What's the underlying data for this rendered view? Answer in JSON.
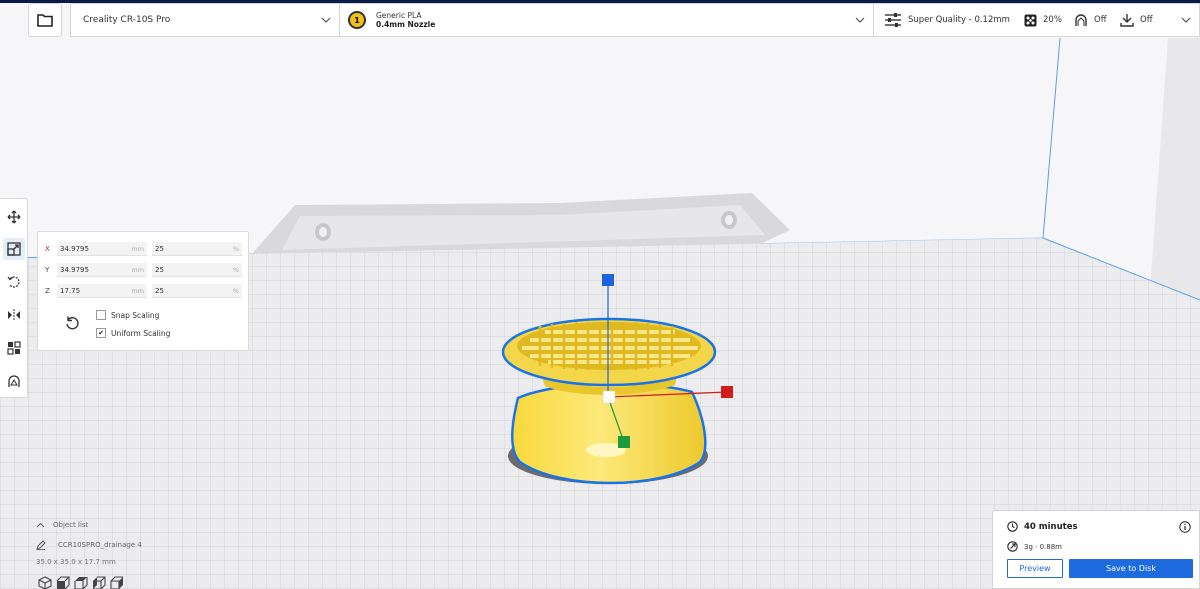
{
  "printer": {
    "name": "Creality CR-10S Pro"
  },
  "material": {
    "extruder_number": "1",
    "name": "Generic PLA",
    "nozzle": "0.4mm Nozzle",
    "badge_color": "#f3c01a"
  },
  "print_settings": {
    "profile": "Super Quality - 0.12mm",
    "infill": "20%",
    "support": "Off",
    "adhesion": "Off"
  },
  "scale_tool": {
    "rows": [
      {
        "axis": "X",
        "value": "34.9795",
        "unit": "mm",
        "percent": "25",
        "pct_sign": "%"
      },
      {
        "axis": "Y",
        "value": "34.9795",
        "unit": "mm",
        "percent": "25",
        "pct_sign": "%"
      },
      {
        "axis": "Z",
        "value": "17.75",
        "unit": "mm",
        "percent": "25",
        "pct_sign": "%"
      }
    ],
    "snap_scaling": {
      "label": "Snap Scaling",
      "checked": false
    },
    "uniform_scaling": {
      "label": "Uniform Scaling",
      "checked": true,
      "mark": "✔"
    }
  },
  "object_list": {
    "header": "Object list",
    "object_name": "CCR10SPRO_drainage 4",
    "dimensions": "35.0 x 35.0 x 17.7 mm"
  },
  "job": {
    "time": "40 minutes",
    "material_usage": "3g · 0.88m",
    "preview_label": "Preview",
    "save_label": "Save to Disk"
  },
  "colors": {
    "accent": "#1e6be0",
    "model_yellow": "#f5dd4b",
    "selection_outline": "#1a73e8",
    "top_strip": "#0a1a4d"
  }
}
